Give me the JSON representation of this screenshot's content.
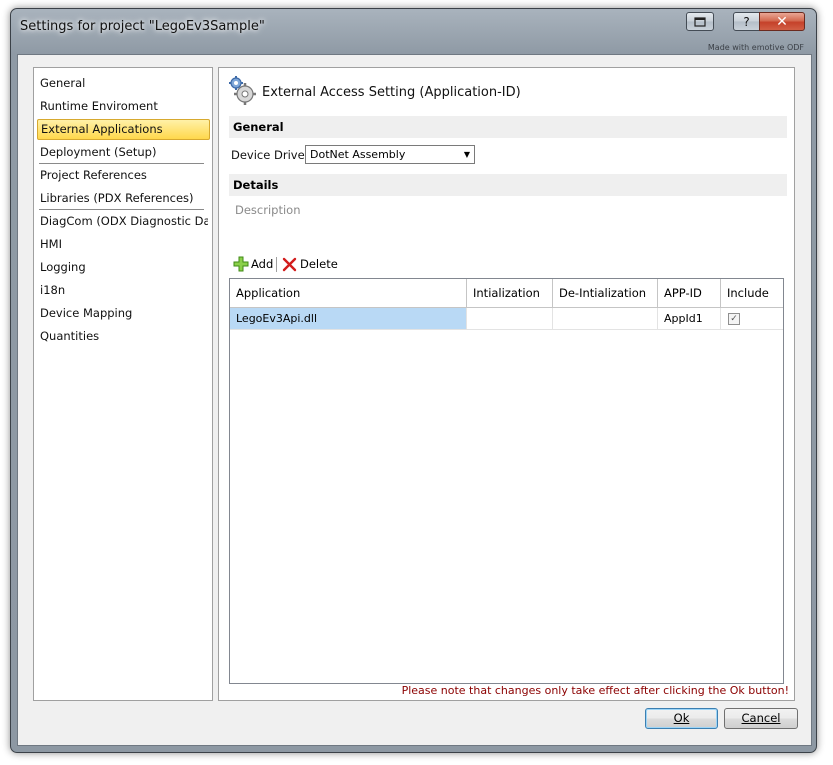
{
  "window": {
    "title": "Settings for project \"LegoEv3Sample\"",
    "made_with": "Made with emotive ODF",
    "help_glyph": "?",
    "close_glyph": "✕"
  },
  "nav": {
    "items": [
      {
        "label": "General"
      },
      {
        "label": "Runtime Enviroment"
      },
      {
        "label": "External Applications",
        "selected": true
      },
      {
        "label": "Deployment (Setup)"
      },
      {
        "label": "Project References"
      },
      {
        "label": "Libraries (PDX References)"
      },
      {
        "label": "DiagCom (ODX Diagnostic Data)"
      },
      {
        "label": "HMI"
      },
      {
        "label": "Logging"
      },
      {
        "label": "i18n"
      },
      {
        "label": "Device Mapping"
      },
      {
        "label": "Quantities"
      }
    ]
  },
  "main": {
    "header_title": "External Access Setting (Application-ID)",
    "header_icon": "gears-icon",
    "section_general": "General",
    "device_driver_label": "Device Driver",
    "device_driver_value": "DotNet Assembly",
    "section_details": "Details",
    "description_label": "Description",
    "toolbar": {
      "add": "Add",
      "delete": "Delete"
    },
    "grid": {
      "columns": [
        "Application",
        "Intialization",
        "De-Intialization",
        "APP-ID",
        "Include"
      ],
      "rows": [
        {
          "application": "LegoEv3Api.dll",
          "initialization": "",
          "deinitialization": "",
          "app_id": "AppId1",
          "include": true
        }
      ]
    },
    "note": "Please note that changes only take effect after clicking the Ok button!"
  },
  "buttons": {
    "ok": "Ok",
    "cancel": "Cancel"
  },
  "colors": {
    "selection_highlight": "#ffd84c",
    "grid_selection": "#b9d9f5",
    "note_text": "#8b0000"
  }
}
